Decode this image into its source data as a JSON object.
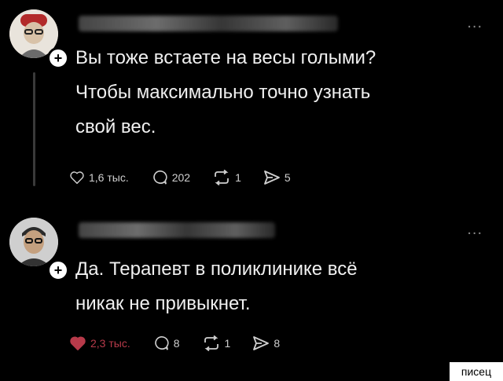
{
  "posts": [
    {
      "text": "Вы тоже встаете на весы голыми?\nЧтобы максимально точно узнать\nсвой вес.",
      "more": "...",
      "actions": {
        "likes": "1,6 тыс.",
        "comments": "202",
        "reposts": "1",
        "shares": "5"
      },
      "liked": false
    },
    {
      "text": "Да. Терапевт в поликлинике всё\nникак не привыкнет.",
      "more": "...",
      "actions": {
        "likes": "2,3 тыс.",
        "comments": "8",
        "reposts": "1",
        "shares": "8"
      },
      "liked": true
    }
  ],
  "watermark": "писец",
  "colors": {
    "background": "#000000",
    "text": "#f0f0f0",
    "liked_heart": "#b73a4a"
  },
  "icons": [
    "heart-icon",
    "comment-icon",
    "repost-icon",
    "share-icon",
    "plus-icon",
    "more-icon"
  ]
}
